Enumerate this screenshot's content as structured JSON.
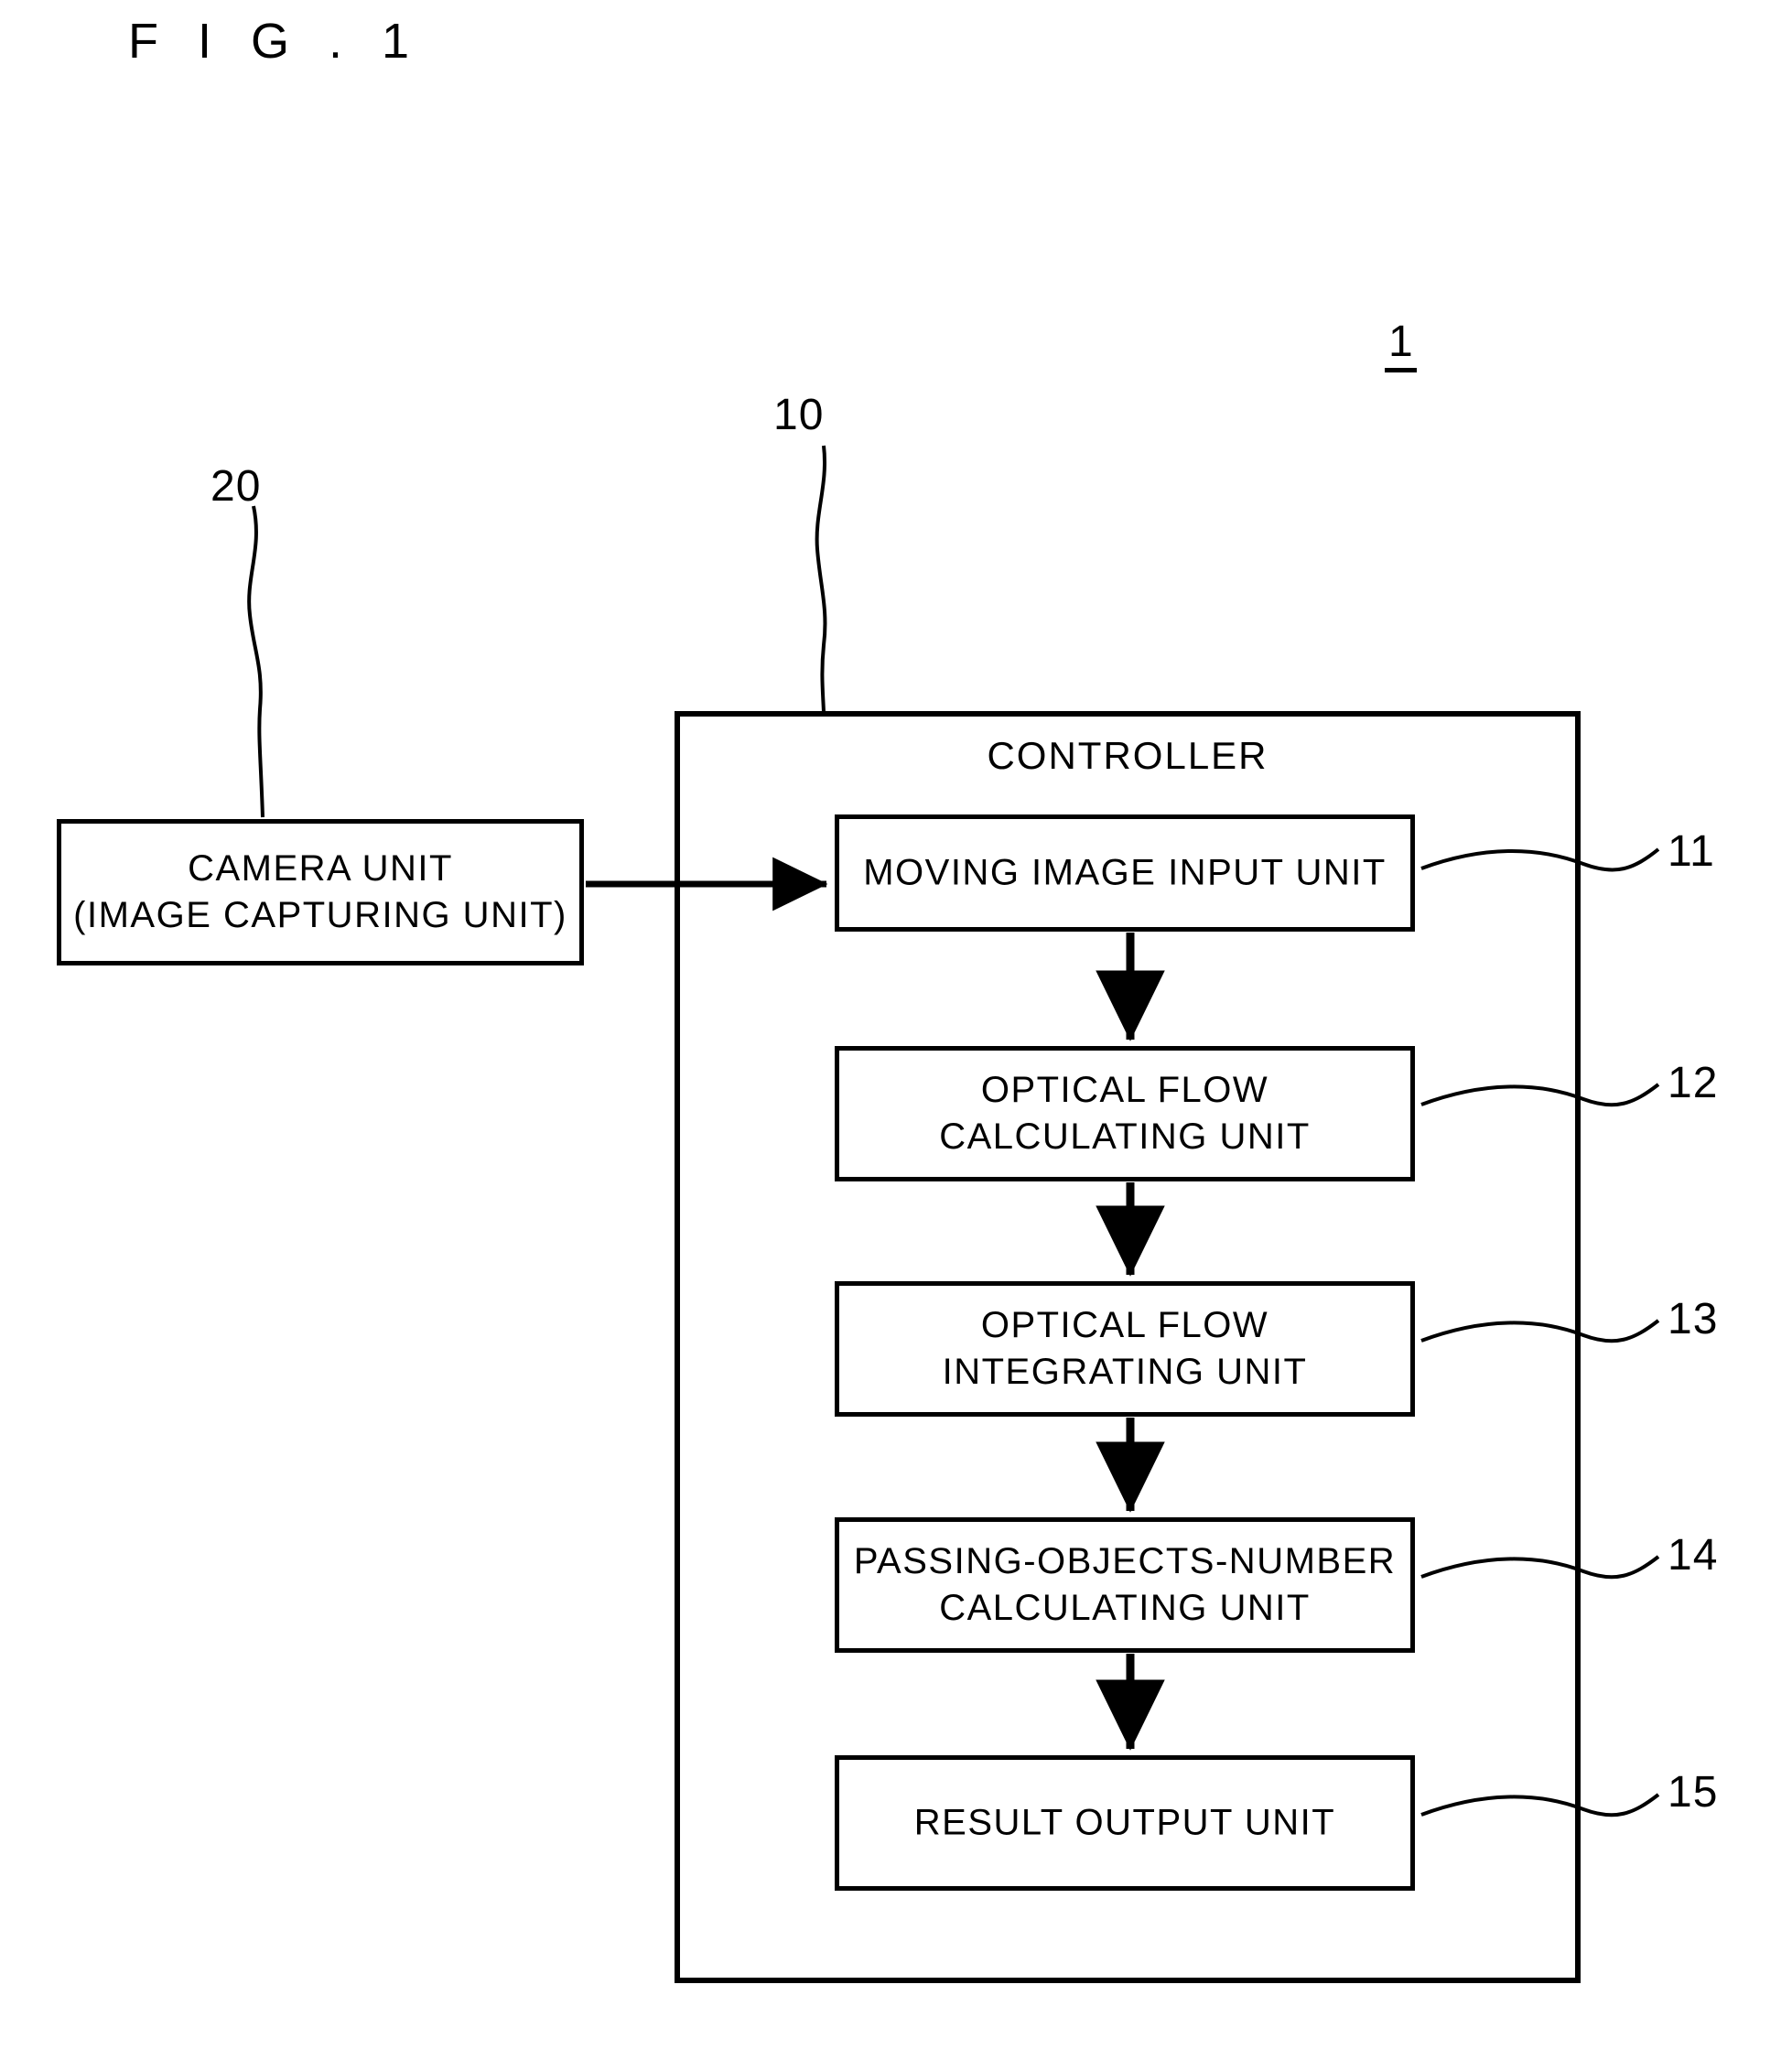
{
  "figure": {
    "title": "F I G . 1",
    "system_reference": "1"
  },
  "blocks": {
    "camera_unit": {
      "label": "CAMERA UNIT\n(IMAGE CAPTURING UNIT)",
      "reference": "20"
    },
    "controller": {
      "label": "CONTROLLER",
      "reference": "10"
    },
    "units": [
      {
        "label": "MOVING IMAGE INPUT UNIT",
        "reference": "11"
      },
      {
        "label": "OPTICAL FLOW\nCALCULATING UNIT",
        "reference": "12"
      },
      {
        "label": "OPTICAL FLOW\nINTEGRATING UNIT",
        "reference": "13"
      },
      {
        "label": "PASSING-OBJECTS-NUMBER\nCALCULATING UNIT",
        "reference": "14"
      },
      {
        "label": "RESULT OUTPUT UNIT",
        "reference": "15"
      }
    ]
  },
  "connections": [
    {
      "name": "camera-to-moving-image-input",
      "type": "arrow-right"
    },
    {
      "name": "moving-image-input-to-optical-flow-calculating",
      "type": "arrow-down"
    },
    {
      "name": "optical-flow-calculating-to-optical-flow-integrating",
      "type": "arrow-down"
    },
    {
      "name": "optical-flow-integrating-to-passing-objects-number",
      "type": "arrow-down"
    },
    {
      "name": "passing-objects-number-to-result-output",
      "type": "arrow-down"
    }
  ],
  "colors": {
    "ink": "#000000",
    "paper": "#ffffff"
  }
}
